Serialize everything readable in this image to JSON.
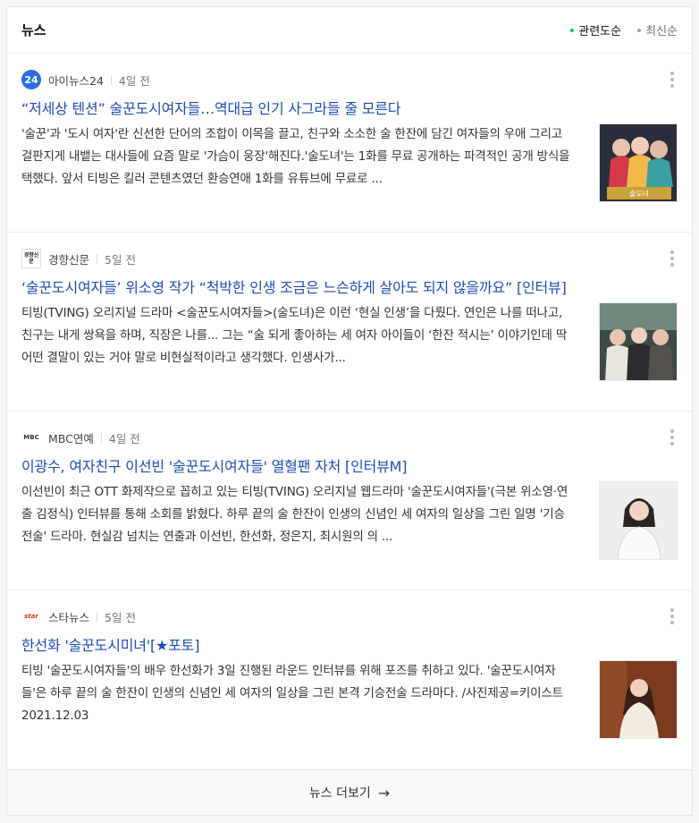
{
  "header": {
    "title": "뉴스",
    "sort": [
      {
        "label": "관련도순",
        "active": true
      },
      {
        "label": "최신순",
        "active": false
      }
    ]
  },
  "articles": [
    {
      "source": "아이뉴스24",
      "logo_text": "24",
      "time": "4일 전",
      "title": "“저세상 텐션” 술꾼도시여자들…역대급 인기 사그라들 줄 모른다",
      "desc": "'술꾼'과 '도시 여자'란 신선한 단어의 조합이 이목을 끌고, 친구와 소소한 술 한잔에 담긴 여자들의 우애 그리고 걸판지게 내뱉는 대사들에 요즘 말로 '가슴이 웅장'해진다.'술도녀'는 1화를 무료 공개하는 파격적인 공개 방식을 택했다. 앞서 티빙은 킬러 콘텐츠였던 환승연애 1화를 유튜브에 무료로 ..."
    },
    {
      "source": "경향신문",
      "logo_text": "경향신문",
      "time": "5일 전",
      "title": "‘술꾼도시여자들’ 위소영 작가 “척박한 인생 조금은 느슨하게 살아도 되지 않을까요” [인터뷰]",
      "desc": "티빙(TVING) 오리지널 드라마 <술꾼도시여자들>(술도녀)은 이런 ‘현실 인생’을 다뤘다. 연인은 나를 떠나고, 친구는 내게 쌍욕을 하며, 직장은 나를... 그는 “술 되게 좋아하는 세 여자 아이들이 ‘한잔 적시는’ 이야기인데 딱 어떤 결말이 있는 거야 말로 비현실적이라고 생각했다. 인생사가..."
    },
    {
      "source": "MBC연예",
      "logo_text": "MBC",
      "time": "4일 전",
      "title": "이광수, 여자친구 이선빈 '술꾼도시여자들' 열혈팬 자처 [인터뷰M]",
      "desc": "이선빈이 최근 OTT 화제작으로 꼽히고 있는 티빙(TVING) 오리지널 웹드라마 '술꾼도시여자들'(극본 위소영·연출 김정식) 인터뷰를 통해 소회를 밝혔다. 하루 끝의 술 한잔이 인생의 신념인 세 여자의 일상을 그린 일명 '기승전술' 드라마. 현실감 넘치는 연출과 이선빈, 한선화, 정은지, 최시원의 의 ..."
    },
    {
      "source": "스타뉴스",
      "logo_text": "star",
      "time": "5일 전",
      "title": "한선화 '술꾼도시미녀'[★포토]",
      "desc": "티빙 '술꾼도시여자들'의 배우 한선화가 3일 진행된 라운드 인터뷰를 위해 포즈를 취하고 있다. '술꾼도시여자들'은 하루 끝의 술 한잔이 인생의 신념인 세 여자의 일상을 그린 본격 기승전술 드라마다. /사진제공=키이스트 2021.12.03"
    }
  ],
  "footer": {
    "label": "뉴스 더보기",
    "arrow": "→"
  },
  "colors": {
    "title": "#1d4fb8",
    "active_dot": "#03c75a",
    "logo_24": "#2a6ee0"
  }
}
